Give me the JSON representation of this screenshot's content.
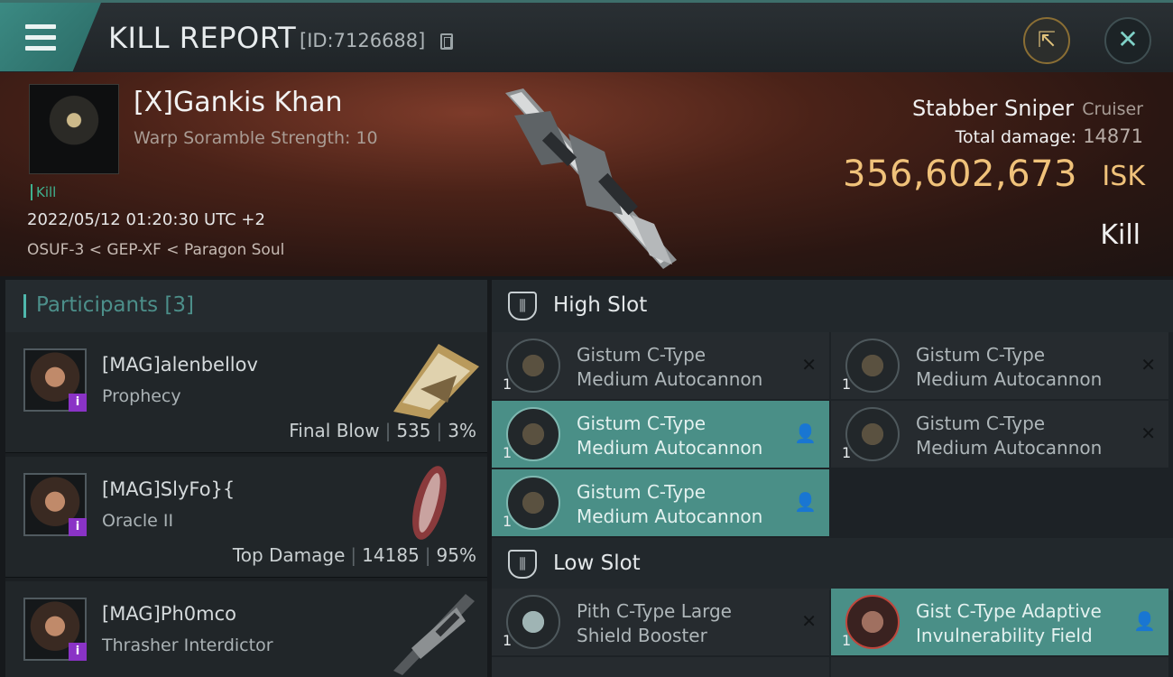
{
  "topbar": {
    "title": "KILL REPORT",
    "report_id": "[ID:7126688]",
    "share_icon": "share-icon",
    "close_icon": "close-icon"
  },
  "victim": {
    "name": "[X]Gankis Khan",
    "subtitle": "Warp Soramble Strength: 10",
    "tag": "Kill",
    "datetime": "2022/05/12 01:20:30 UTC +2",
    "location": "OSUF-3 < GEP-XF < Paragon Soul",
    "ship_name": "Stabber Sniper",
    "ship_class": "Cruiser",
    "damage_label": "Total damage:",
    "damage_value": "14871",
    "isk_value": "356,602,673",
    "isk_unit": "ISK",
    "result": "Kill"
  },
  "participants": {
    "header": "Participants [3]",
    "rows": [
      {
        "name": "[MAG]alenbellov",
        "ship": "Prophecy",
        "role": "Final Blow",
        "damage": "535",
        "percent": "3%",
        "badge": "i"
      },
      {
        "name": "[MAG]SlyFo}{",
        "ship": "Oracle II",
        "role": "Top Damage",
        "damage": "14185",
        "percent": "95%",
        "badge": "i"
      },
      {
        "name": "[MAG]Ph0mco",
        "ship": "Thrasher Interdictor",
        "badge": "i"
      }
    ]
  },
  "slots": {
    "high": {
      "label": "High Slot",
      "items": [
        {
          "qty": "1",
          "line1": "Gistum C-Type",
          "line2": "Medium Autocannon",
          "state": "destroyed"
        },
        {
          "qty": "1",
          "line1": "Gistum C-Type",
          "line2": "Medium Autocannon",
          "state": "destroyed"
        },
        {
          "qty": "1",
          "line1": "Gistum C-Type",
          "line2": "Medium Autocannon",
          "state": "dropped"
        },
        {
          "qty": "1",
          "line1": "Gistum C-Type",
          "line2": "Medium Autocannon",
          "state": "destroyed"
        },
        {
          "qty": "1",
          "line1": "Gistum C-Type",
          "line2": "Medium Autocannon",
          "state": "dropped"
        }
      ]
    },
    "low": {
      "label": "Low Slot",
      "items": [
        {
          "qty": "1",
          "line1": "Pith C-Type Large",
          "line2": "Shield Booster",
          "state": "destroyed"
        },
        {
          "qty": "1",
          "line1": "Gist C-Type Adaptive",
          "line2": "Invulnerability Field",
          "state": "dropped"
        }
      ]
    }
  },
  "colors": {
    "accent": "#4a8f87",
    "isk": "#f0c27a",
    "badge": "#8a33c6"
  }
}
